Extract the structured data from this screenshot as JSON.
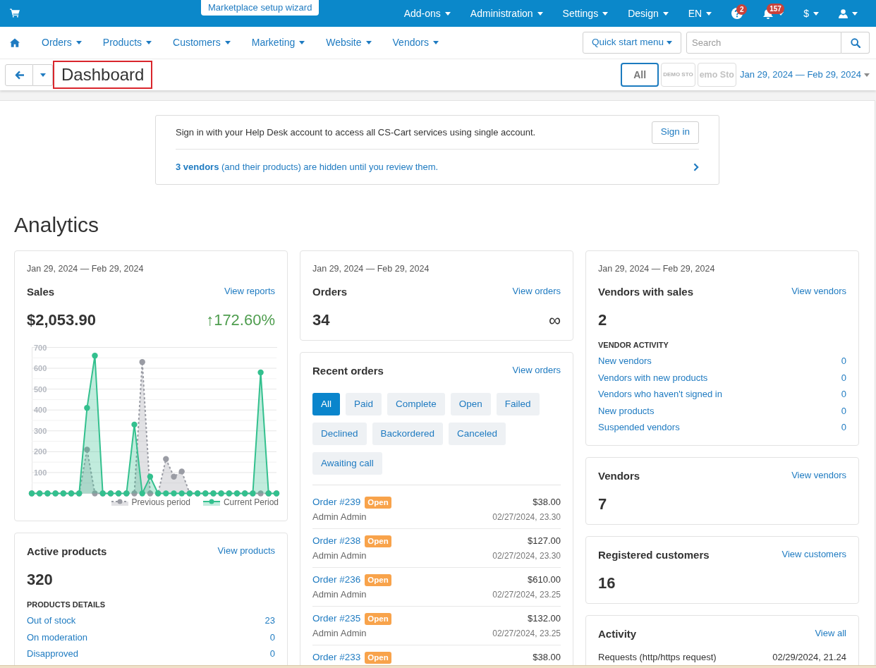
{
  "top_bar": {
    "wizard_tab": "Marketplace setup wizard",
    "menus": [
      {
        "kind": "menu",
        "label": "Add-ons"
      },
      {
        "kind": "menu",
        "label": "Administration"
      },
      {
        "kind": "menu",
        "label": "Settings"
      },
      {
        "kind": "menu",
        "label": "Design"
      },
      {
        "kind": "menu",
        "label": "EN"
      },
      {
        "kind": "help",
        "badge": "2"
      },
      {
        "kind": "notifications",
        "badge": "157"
      },
      {
        "kind": "menu",
        "label": "$"
      },
      {
        "kind": "user"
      }
    ]
  },
  "nav": {
    "items": [
      "Orders",
      "Products",
      "Customers",
      "Marketing",
      "Website",
      "Vendors"
    ],
    "quick_start": "Quick start menu",
    "search": {
      "placeholder": "Search"
    }
  },
  "page_header": {
    "title": "Dashboard",
    "storefronts": [
      {
        "kind": "text",
        "label": "All",
        "selected": true
      },
      {
        "kind": "logo_small",
        "label": "DEMO STO",
        "selected": false
      },
      {
        "kind": "logo",
        "label": "emo Sto",
        "selected": false
      }
    ],
    "date_range": "Jan 29, 2024 — Feb 29, 2024"
  },
  "notice": {
    "text": "Sign in with your Help Desk account to access all CS-Cart services using single account.",
    "button": "Sign in",
    "message": "**3 vendors** (and their products) are hidden until you review them."
  },
  "analytics": {
    "title": "Analytics",
    "columns": [
      {
        "cards": [
          {
            "kind": "sales",
            "date": "Jan 29, 2024 — Feb 29, 2024",
            "title": "Sales",
            "link": "View reports",
            "value": "$2,053.90",
            "change": "↑172.60%",
            "chart_data": {
              "type": "area",
              "ylim": [
                0,
                700
              ],
              "yticks": [
                100,
                200,
                300,
                400,
                500,
                600,
                700
              ],
              "grid": true,
              "legend": "bottom-right",
              "series": [
                {
                  "name": "Previous period",
                  "color": "#9a9ca4",
                  "values": [
                    0,
                    0,
                    0,
                    0,
                    0,
                    0,
                    0,
                    210,
                    0,
                    0,
                    0,
                    0,
                    0,
                    0,
                    630,
                    0,
                    0,
                    165,
                    80,
                    105,
                    0,
                    0,
                    0,
                    0,
                    0,
                    0,
                    0,
                    0,
                    0,
                    0,
                    0,
                    0
                  ]
                },
                {
                  "name": "Current Period",
                  "color": "#33c08e",
                  "values": [
                    0,
                    0,
                    0,
                    0,
                    0,
                    0,
                    0,
                    410,
                    660,
                    0,
                    0,
                    0,
                    0,
                    330,
                    0,
                    80,
                    0,
                    0,
                    0,
                    0,
                    0,
                    0,
                    0,
                    0,
                    0,
                    0,
                    0,
                    0,
                    0,
                    580,
                    0,
                    0
                  ]
                }
              ]
            }
          },
          {
            "kind": "stat",
            "title": "Active products",
            "link": "View products",
            "value": "320",
            "details_title": "PRODUCTS DETAILS",
            "details": [
              {
                "label": "Out of stock",
                "count": "23"
              },
              {
                "label": "On moderation",
                "count": "0"
              },
              {
                "label": "Disapproved",
                "count": "0"
              }
            ]
          }
        ]
      },
      {
        "cards": [
          {
            "kind": "stat",
            "date": "Jan 29, 2024 — Feb 29, 2024",
            "title": "Orders",
            "link": "View orders",
            "value": "34",
            "change": "∞"
          },
          {
            "kind": "orders",
            "title": "Recent orders",
            "link": "View orders",
            "filters": [
              {
                "label": "All",
                "selected": true
              },
              {
                "label": "Paid",
                "selected": false
              },
              {
                "label": "Complete",
                "selected": false
              },
              {
                "label": "Open",
                "selected": false
              },
              {
                "label": "Failed",
                "selected": false
              },
              {
                "label": "Declined",
                "selected": false
              },
              {
                "label": "Backordered",
                "selected": false
              },
              {
                "label": "Canceled",
                "selected": false
              },
              {
                "label": "Awaiting call",
                "selected": false
              }
            ],
            "orders": [
              {
                "number": "Order #239",
                "status": "Open",
                "total": "$38.00",
                "customer": "Admin Admin",
                "date": "02/27/2024, 23.30"
              },
              {
                "number": "Order #238",
                "status": "Open",
                "total": "$127.00",
                "customer": "Admin Admin",
                "date": "02/27/2024, 23.30"
              },
              {
                "number": "Order #236",
                "status": "Open",
                "total": "$610.00",
                "customer": "Admin Admin",
                "date": "02/27/2024, 23.25"
              },
              {
                "number": "Order #235",
                "status": "Open",
                "total": "$132.00",
                "customer": "Admin Admin",
                "date": "02/27/2024, 23.25"
              },
              {
                "number": "Order #233",
                "status": "Open",
                "total": "$38.00"
              }
            ]
          }
        ]
      },
      {
        "cards": [
          {
            "kind": "stat",
            "date": "Jan 29, 2024 — Feb 29, 2024",
            "title": "Vendors with sales",
            "link": "View vendors",
            "value": "2",
            "details_title": "VENDOR ACTIVITY",
            "details": [
              {
                "label": "New vendors",
                "count": "0"
              },
              {
                "label": "Vendors with new products",
                "count": "0"
              },
              {
                "label": "Vendors who haven't signed in",
                "count": "0"
              },
              {
                "label": "New products",
                "count": "0"
              },
              {
                "label": "Suspended vendors",
                "count": "0"
              }
            ]
          },
          {
            "kind": "stat",
            "title": "Vendors",
            "link": "View vendors",
            "value": "7"
          },
          {
            "kind": "stat",
            "title": "Registered customers",
            "link": "View customers",
            "value": "16"
          },
          {
            "kind": "activity",
            "title": "Activity",
            "link": "View all",
            "rows": [
              {
                "label": "Requests (http/https request)",
                "date": "02/29/2024, 21.24"
              }
            ]
          }
        ]
      }
    ]
  }
}
